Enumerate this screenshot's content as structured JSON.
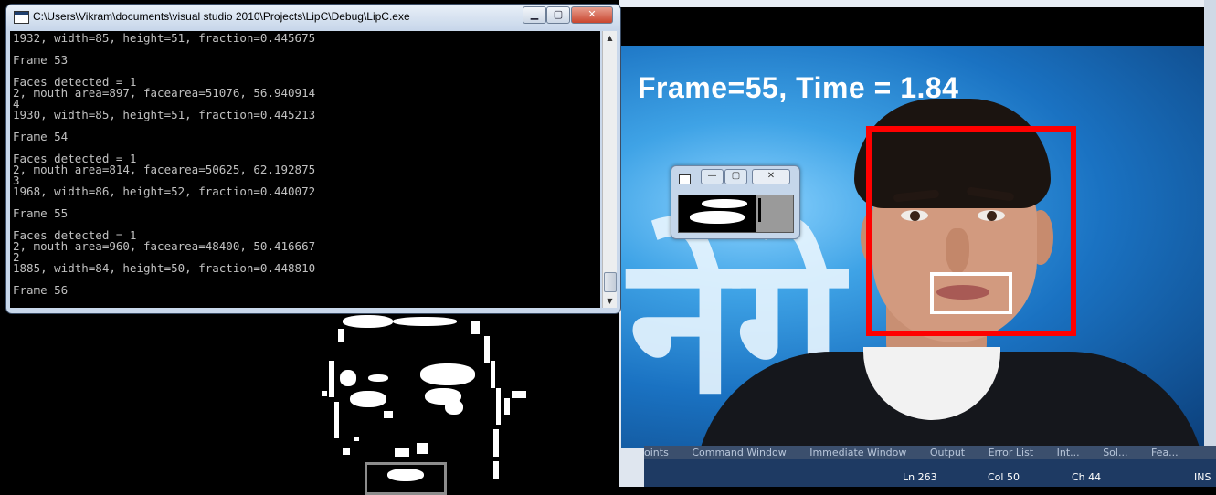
{
  "console": {
    "title": "C:\\Users\\Vikram\\documents\\visual studio 2010\\Projects\\LipC\\Debug\\LipC.exe",
    "buttons": {
      "minimize": "▁",
      "maximize": "▢",
      "close": "✕"
    },
    "lines": [
      "1932, width=85, height=51, fraction=0.445675",
      "",
      "Frame 53",
      "",
      "Faces detected = 1",
      "2, mouth area=897, facearea=51076, 56.940914",
      "4",
      "1930, width=85, height=51, fraction=0.445213",
      "",
      "Frame 54",
      "",
      "Faces detected = 1",
      "2, mouth area=814, facearea=50625, 62.192875",
      "3",
      "1968, width=86, height=52, fraction=0.440072",
      "",
      "Frame 55",
      "",
      "Faces detected = 1",
      "2, mouth area=960, facearea=48400, 50.416667",
      "2",
      "1885, width=84, height=50, fraction=0.448810",
      "",
      "Frame 56"
    ]
  },
  "video": {
    "overlay_text": "Frame=55, Time = 1.84",
    "background_text": "नेगे"
  },
  "lip_window": {
    "buttons": {
      "minimize": "—",
      "maximize": "▢",
      "close": "✕"
    }
  },
  "vs_panel_tabs": [
    "oints",
    "Command Window",
    "Immediate Window",
    "Output",
    "Error List",
    "Int...",
    "Sol...",
    "Fea..."
  ],
  "vs_status": {
    "line": "Ln 263",
    "col": "Col 50",
    "ch": "Ch 44",
    "mode": "INS"
  },
  "colors": {
    "face_box": "#ff0000",
    "mouth_box": "#ffffff",
    "console_bg": "#000000",
    "console_text": "#c0c0c0",
    "status_bar": "#1e3a63"
  }
}
